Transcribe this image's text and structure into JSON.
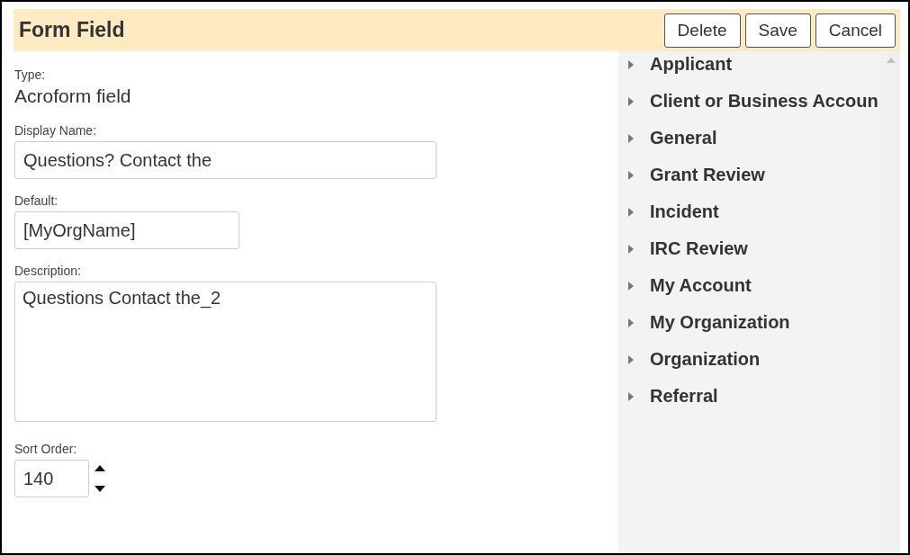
{
  "header": {
    "title": "Form Field",
    "buttons": [
      "Delete",
      "Save",
      "Cancel"
    ]
  },
  "form": {
    "type_label": "Type:",
    "type_value": "Acroform field",
    "display_name": {
      "label": "Display Name:",
      "value": "Questions? Contact the"
    },
    "default": {
      "label": "Default:",
      "value": "[MyOrgName]"
    },
    "description": {
      "label": "Description:",
      "value": "Questions Contact the_2"
    },
    "sort_order": {
      "label": "Sort Order:",
      "value": "140"
    }
  },
  "tree": {
    "items": [
      {
        "label": "Applicant",
        "expanded": false
      },
      {
        "label": "Client or Business Accoun",
        "expanded": false
      },
      {
        "label": "General",
        "expanded": false
      },
      {
        "label": "Grant Review",
        "expanded": false
      },
      {
        "label": "Incident",
        "expanded": false
      },
      {
        "label": "IRC Review",
        "expanded": false
      },
      {
        "label": "My Account",
        "expanded": false
      },
      {
        "label": "My Organization",
        "expanded": false
      },
      {
        "label": "Organization",
        "expanded": false
      },
      {
        "label": "Referral",
        "expanded": false
      }
    ]
  }
}
